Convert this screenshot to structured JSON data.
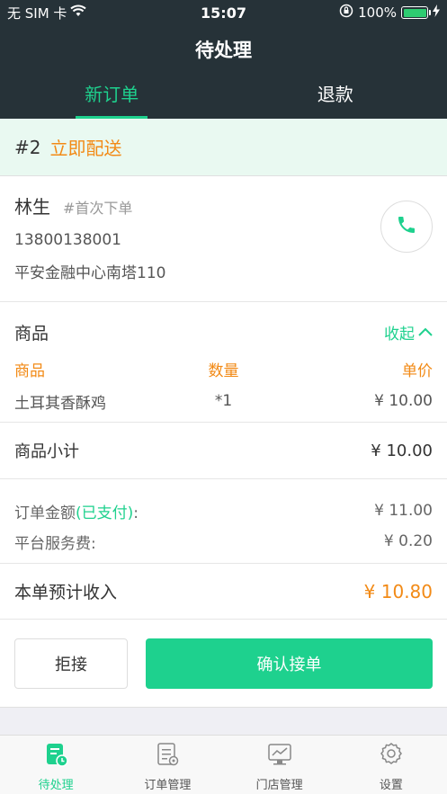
{
  "status_bar": {
    "carrier": "无 SIM 卡",
    "time": "15:07",
    "battery_percent": "100%",
    "battery_level": 1.0,
    "icons": [
      "wifi-icon",
      "orientation-lock-icon",
      "battery-icon",
      "charging-icon"
    ]
  },
  "header": {
    "title": "待处理",
    "tabs": [
      {
        "label": "新订单",
        "active": true
      },
      {
        "label": "退款",
        "active": false
      }
    ]
  },
  "order": {
    "number": "#2",
    "status": "立即配送",
    "customer": {
      "name": "林生",
      "tag": "#首次下单",
      "phone": "13800138001",
      "address": "平安金融中心南塔110"
    },
    "goods": {
      "title": "商品",
      "collapse_label": "收起",
      "headers": [
        "商品",
        "数量",
        "单价"
      ],
      "items": [
        {
          "name": "土耳其香酥鸡",
          "qty": "*1",
          "price": "¥ 10.00"
        }
      ]
    },
    "subtotal": {
      "label": "商品小计",
      "value": "¥ 10.00"
    },
    "amount": {
      "label": "订单金额",
      "paid_label": "(已支付)",
      "colon": ":",
      "value": "¥ 11.00"
    },
    "service_fee": {
      "label": "平台服务费:",
      "value": "¥ 0.20"
    },
    "income": {
      "label": "本单预计收入",
      "value": "¥ 10.80"
    },
    "actions": {
      "reject": "拒接",
      "accept": "确认接单"
    }
  },
  "tabbar": [
    {
      "label": "待处理",
      "icon": "pending-orders-icon",
      "active": true
    },
    {
      "label": "订单管理",
      "icon": "order-management-icon",
      "active": false
    },
    {
      "label": "门店管理",
      "icon": "store-management-icon",
      "active": false
    },
    {
      "label": "设置",
      "icon": "settings-gear-icon",
      "active": false
    }
  ],
  "colors": {
    "accent": "#1ed18e",
    "orange": "#f28a16",
    "header_bg": "#263238"
  }
}
